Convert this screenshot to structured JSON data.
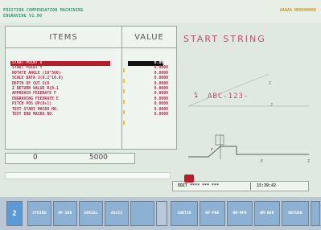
{
  "header": {
    "line1": "POSITION COMPENSATION MACHINING",
    "line2": "ENGRAVING V1.00",
    "right": "AAAAA   N00000000"
  },
  "table": {
    "items_header": "ITEMS",
    "value_header": "VALUE",
    "rows": [
      {
        "label": "START POINT X",
        "value": "0.0000"
      },
      {
        "label": "START POINT Y",
        "value": "0.0000"
      },
      {
        "label": "ROTATE ANGLE (10^360)",
        "value": "0.0000"
      },
      {
        "label": "SCALE DATA J(0.2^10.0)",
        "value": "0.0000"
      },
      {
        "label": "DEPTH OF CUT Z(0",
        "value": "0.0000"
      },
      {
        "label": "Z RETURN VALUE R(0.1",
        "value": "0.0000"
      },
      {
        "label": "APPROACH FEEDRATE F",
        "value": "0.0000"
      },
      {
        "label": "ENGRAVING FEEDRATE E",
        "value": "0.0000"
      },
      {
        "label": "PITCH POS UP(0+1)",
        "value": "0.0000"
      },
      {
        "label": "TEXT START MACRO NO.",
        "value": "0.0000"
      },
      {
        "label": "TEXT END MACRO NO.",
        "value": "0.0000"
      }
    ]
  },
  "counter": {
    "left": "0",
    "right": "5000"
  },
  "diagram": {
    "title": "START STRING",
    "string": "ABC-123-",
    "label_k": "K",
    "label_i": "I",
    "label_j": "J",
    "label_f": "F",
    "label_e": "E",
    "label_z": "Z"
  },
  "status": {
    "mode": "EDIT **** *** ***",
    "time": "15:39:42"
  },
  "softkeys": [
    "2",
    "STRING",
    "DF-SER",
    "SERIAL",
    "ASCII",
    "",
    "",
    "CONTIN",
    "NF-PRE",
    "NM-MPR",
    "NM-RER",
    "RETURN",
    ""
  ],
  "colors": {
    "accent": "#b51d2a",
    "text_red": "#b8284a",
    "key_blue": "#8db1d3",
    "header_green": "#2e9a6c"
  }
}
